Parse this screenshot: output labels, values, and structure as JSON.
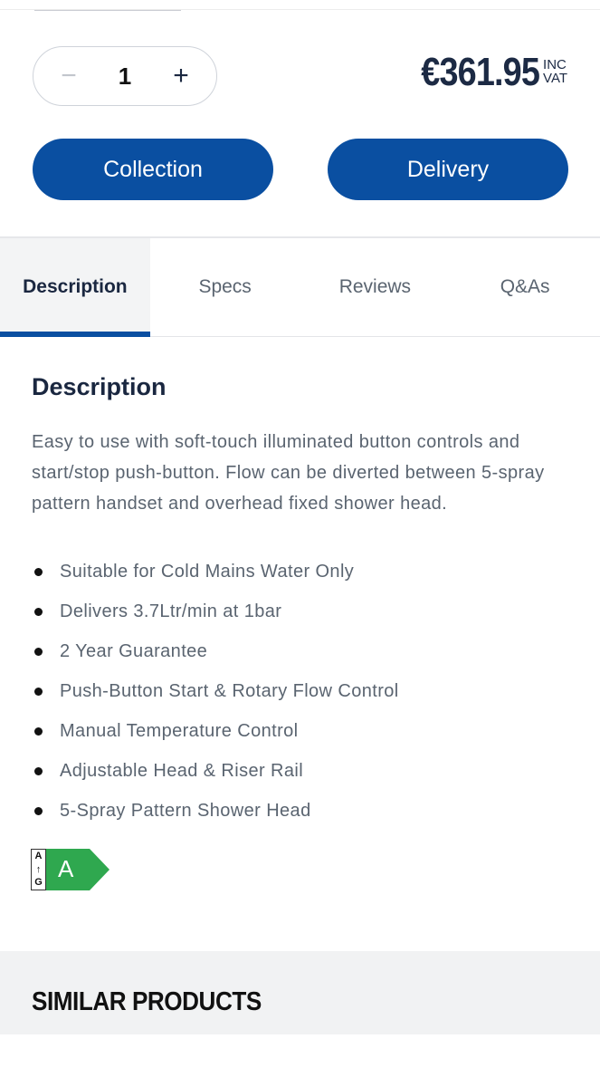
{
  "quantity": {
    "minus": "−",
    "value": "1",
    "plus": "+"
  },
  "price": {
    "amount": "€361.95",
    "vat_line1": "INC",
    "vat_line2": "VAT"
  },
  "buttons": {
    "collection": "Collection",
    "delivery": "Delivery"
  },
  "tabs": [
    {
      "label": "Description",
      "active": true
    },
    {
      "label": "Specs",
      "active": false
    },
    {
      "label": "Reviews",
      "active": false
    },
    {
      "label": "Q&As",
      "active": false
    }
  ],
  "description": {
    "heading": "Description",
    "text": "Easy to use with soft-touch illuminated button controls and start/stop push-button. Flow can be diverted between 5-spray pattern handset and overhead fixed shower head.",
    "features": [
      "Suitable for Cold Mains Water Only",
      "Delivers 3.7Ltr/min at 1bar",
      "2 Year Guarantee",
      "Push-Button Start & Rotary Flow Control",
      "Manual Temperature Control",
      "Adjustable Head & Riser Rail",
      "5-Spray Pattern Shower Head"
    ]
  },
  "energy_label": {
    "scale_top": "A",
    "scale_arrow": "↑",
    "scale_bottom": "G",
    "grade": "A",
    "color": "#2fa84f"
  },
  "similar": {
    "heading": "SIMILAR PRODUCTS"
  },
  "colors": {
    "primary": "#0a4fa1",
    "text": "#1a2740",
    "muted": "#5a6470"
  }
}
